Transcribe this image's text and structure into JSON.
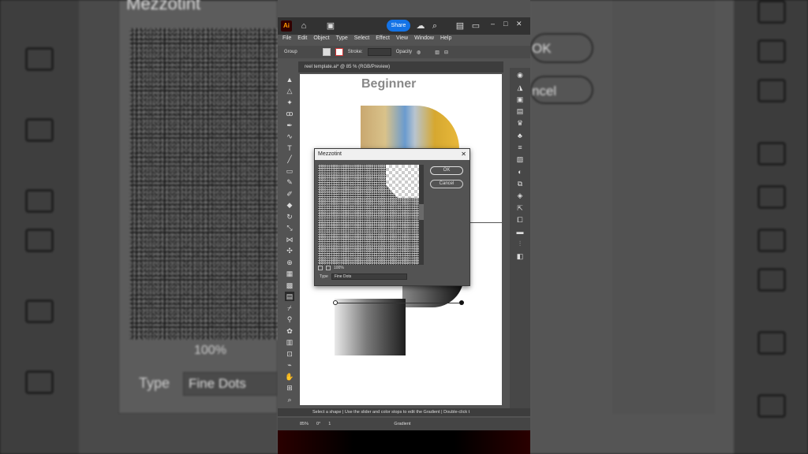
{
  "app": {
    "logo": "Ai",
    "share_label": "Share",
    "menu": [
      "File",
      "Edit",
      "Object",
      "Type",
      "Select",
      "Effect",
      "View",
      "Window",
      "Help"
    ],
    "control_bar": {
      "selection": "Group",
      "stroke_label": "Stroke:",
      "opacity_label": "Opacity"
    },
    "doc_tab": "reel template.ai* @ 85 % (RGB/Preview)",
    "status_text": "Select a shape  |  Use the slider and color stops to edit the Gradient  |  Double-click t",
    "bottom": {
      "zoom": "85%",
      "rotation": "0°",
      "artboard": "1",
      "tool_name": "Gradient"
    }
  },
  "canvas": {
    "heading": "Beginner"
  },
  "dialog": {
    "title": "Mezzotint",
    "ok_label": "OK",
    "cancel_label": "Cancel",
    "zoom": "100%",
    "type_label": "Type",
    "type_value": "Fine Dots"
  },
  "background": {
    "title": "Mezzotint",
    "ok_label": "OK",
    "cancel_label": "ncel",
    "zoom": "100%",
    "type_label": "Type",
    "type_value": "Fine Dots"
  },
  "colors": {
    "accent": "#1473e6",
    "panel": "#535353",
    "dark": "#323232"
  }
}
